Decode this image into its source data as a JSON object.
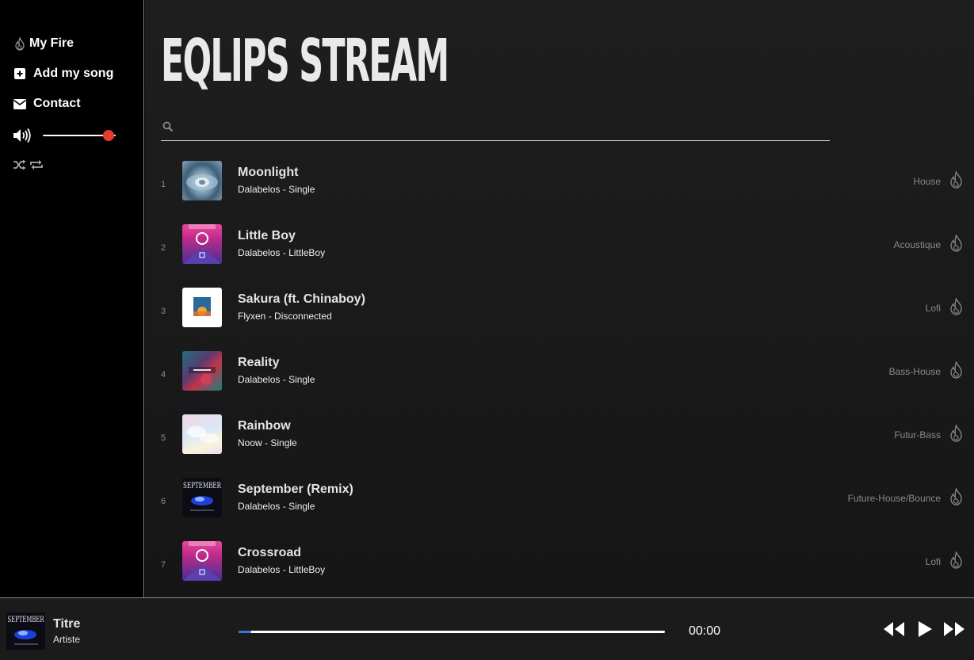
{
  "sidebar": {
    "items": [
      {
        "label": "My Fire",
        "icon": "flame-icon"
      },
      {
        "label": "Add my song",
        "icon": "plus-square-icon"
      },
      {
        "label": "Contact",
        "icon": "envelope-icon"
      }
    ],
    "volume": {
      "icon": "volume-icon",
      "level": 0.9,
      "knob_color": "#e83a30"
    },
    "modes": [
      {
        "icon": "shuffle-icon"
      },
      {
        "icon": "repeat-icon"
      }
    ]
  },
  "main": {
    "title": "EQLIPS STREAM",
    "search": {
      "placeholder": "",
      "value": "",
      "icon": "search-icon"
    },
    "tracks": [
      {
        "num": "1",
        "title": "Moonlight",
        "artist": "Dalabelos",
        "album": "Single",
        "genre": "House"
      },
      {
        "num": "2",
        "title": "Little Boy",
        "artist": "Dalabelos",
        "album": "LittleBoy",
        "genre": "Acoustique"
      },
      {
        "num": "3",
        "title": "Sakura (ft. Chinaboy)",
        "artist": "Flyxen",
        "album": "Disconnected",
        "genre": "Lofi"
      },
      {
        "num": "4",
        "title": "Reality",
        "artist": "Dalabelos",
        "album": "Single",
        "genre": "Bass-House"
      },
      {
        "num": "5",
        "title": "Rainbow",
        "artist": "Noow",
        "album": "Single",
        "genre": "Futur-Bass"
      },
      {
        "num": "6",
        "title": "September (Remix)",
        "artist": "Dalabelos",
        "album": "Single",
        "genre": "Future-House/Bounce"
      },
      {
        "num": "7",
        "title": "Crossroad",
        "artist": "Dalabelos",
        "album": "LittleBoy",
        "genre": "Lofi"
      }
    ],
    "separator": "-"
  },
  "player": {
    "title": "Titre",
    "artist": "Artiste",
    "time": "00:00",
    "progress": 0.03,
    "progress_color": "#2e7bdb",
    "cover_text": "SEPTEMBER",
    "controls": [
      {
        "icon": "rewind-icon"
      },
      {
        "icon": "play-icon"
      },
      {
        "icon": "fast-forward-icon"
      }
    ]
  }
}
